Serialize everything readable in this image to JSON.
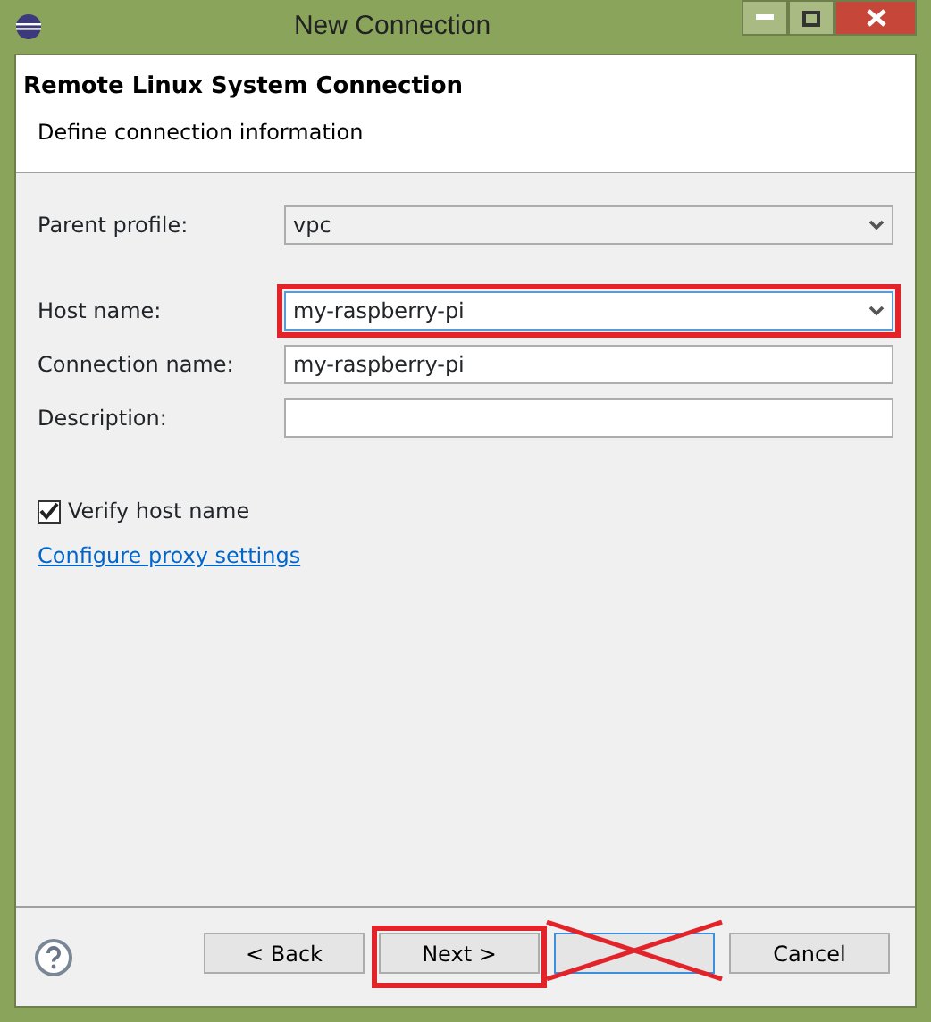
{
  "window": {
    "title": "New Connection"
  },
  "header": {
    "title": "Remote Linux System Connection",
    "description": "Define connection information"
  },
  "fields": [
    {
      "kind": "combo",
      "label": "Parent profile:",
      "value": "vpc",
      "highlighted": false
    },
    {
      "kind": "combo",
      "label": "Host name:",
      "value": "my-raspberry-pi",
      "highlighted": true
    },
    {
      "kind": "text",
      "label": "Connection name:",
      "value": "my-raspberry-pi",
      "highlighted": false
    },
    {
      "kind": "text",
      "label": "Description:",
      "highlighted": false
    }
  ],
  "verify_host_name": {
    "label": "Verify host name",
    "checked": true
  },
  "proxy_link": "Configure proxy settings",
  "buttons": [
    {
      "label": "< Back",
      "highlighted": false,
      "crossed_out": false,
      "focused": false
    },
    {
      "label": "Next >",
      "highlighted": true,
      "crossed_out": false,
      "focused": false
    },
    {
      "highlighted": false,
      "crossed_out": true,
      "focused": true
    },
    {
      "label": "Cancel",
      "highlighted": false,
      "crossed_out": false,
      "focused": false
    }
  ]
}
